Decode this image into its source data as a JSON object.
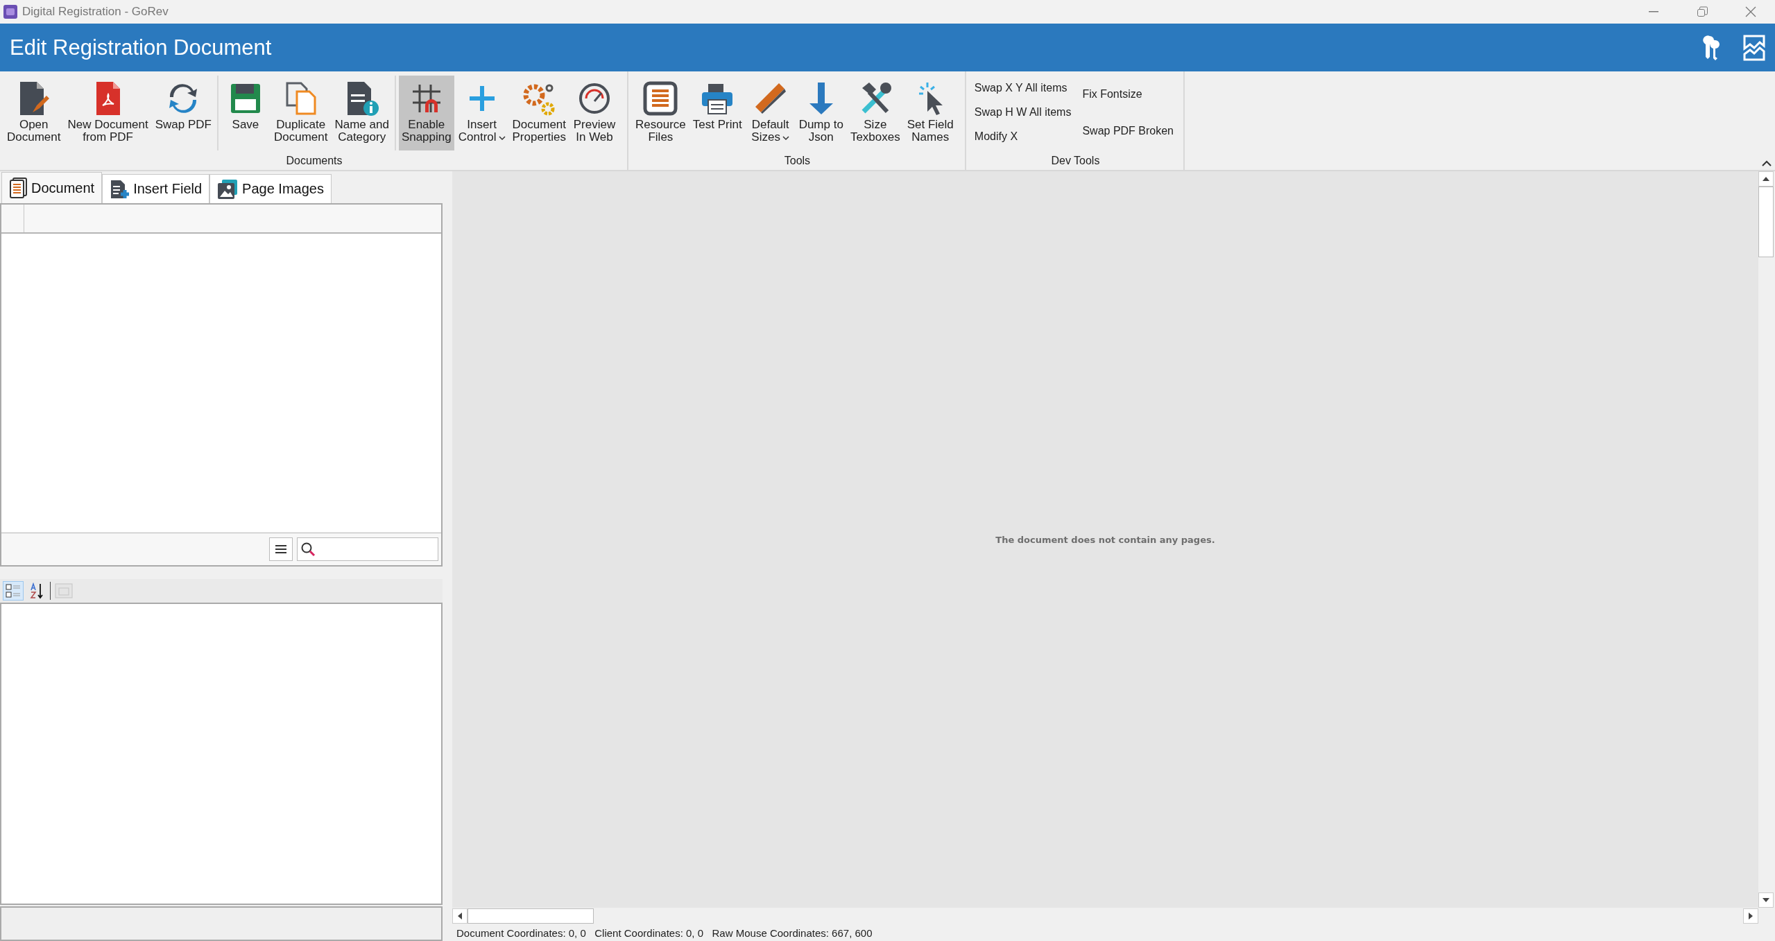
{
  "window": {
    "title": "Digital Registration - GoRev"
  },
  "header": {
    "title": "Edit Registration Document"
  },
  "ribbon": {
    "groups": [
      {
        "label": "Documents",
        "sections": [
          [
            {
              "label": "Open\nDocument",
              "checked": false,
              "dropdown": false
            },
            {
              "label": "New Document\nfrom PDF",
              "checked": false,
              "dropdown": false
            },
            {
              "label": "Swap PDF",
              "checked": false,
              "dropdown": false
            }
          ],
          [
            {
              "label": "Save",
              "checked": false,
              "dropdown": false
            },
            {
              "label": "Duplicate\nDocument",
              "checked": false,
              "dropdown": false
            },
            {
              "label": "Name and\nCategory",
              "checked": false,
              "dropdown": false
            }
          ],
          [
            {
              "label": "Enable\nSnapping",
              "checked": true,
              "dropdown": false
            },
            {
              "label": "Insert\nControl",
              "checked": false,
              "dropdown": true
            },
            {
              "label": "Document\nProperties",
              "checked": false,
              "dropdown": false
            },
            {
              "label": "Preview\nIn Web",
              "checked": false,
              "dropdown": false
            }
          ]
        ]
      },
      {
        "label": "Tools",
        "sections": [
          [
            {
              "label": "Resource\nFiles",
              "checked": false,
              "dropdown": false
            },
            {
              "label": "Test Print",
              "checked": false,
              "dropdown": false
            },
            {
              "label": "Default\nSizes",
              "checked": false,
              "dropdown": true
            },
            {
              "label": "Dump to\nJson",
              "checked": false,
              "dropdown": false
            },
            {
              "label": "Size\nTexboxes",
              "checked": false,
              "dropdown": false
            },
            {
              "label": "Set Field\nNames",
              "checked": false,
              "dropdown": false
            }
          ]
        ]
      },
      {
        "label": "Dev Tools",
        "small_columns": [
          [
            "Swap X Y All items",
            "Swap H W All items",
            "Modify X"
          ],
          [
            "Fix Fontsize",
            "Swap PDF Broken"
          ]
        ]
      }
    ]
  },
  "left_panel": {
    "tabs": [
      {
        "label": "Document",
        "selected": true
      },
      {
        "label": "Insert Field",
        "selected": false
      },
      {
        "label": "Page Images",
        "selected": false
      }
    ],
    "property_view_buttons": [
      {
        "selected": true
      },
      {
        "selected": false
      }
    ],
    "property_pages_button": {
      "disabled": true
    }
  },
  "document_view": {
    "message": "The document does not contain any pages."
  },
  "status_bar": "Document Coordinates: 0, 0   Client Coordinates: 0, 0   Raw Mouse Coordinates: 667, 600"
}
